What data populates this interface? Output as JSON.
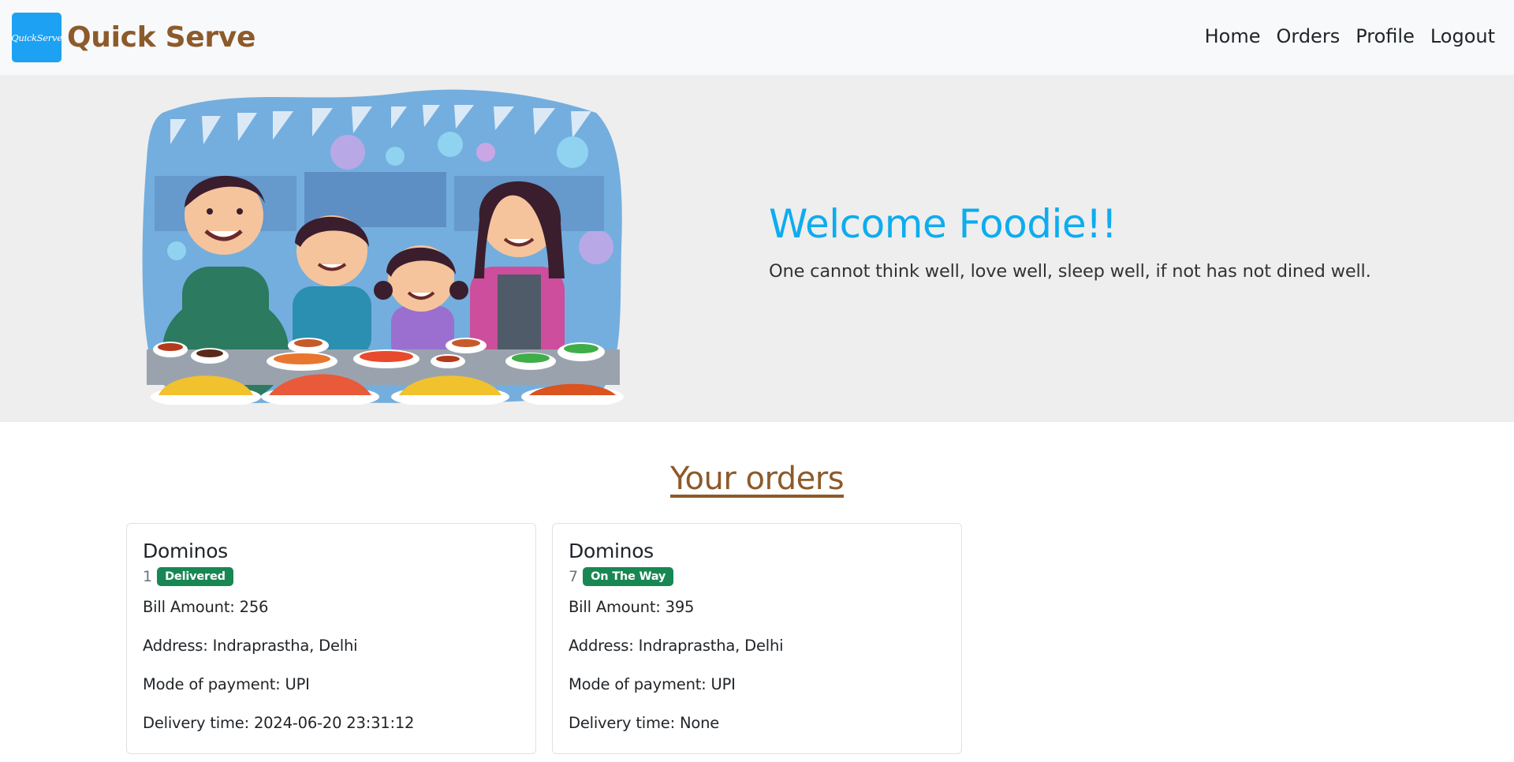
{
  "navbar": {
    "logo_text": "QuickServe",
    "brand_name": "Quick Serve",
    "links": [
      {
        "label": "Home"
      },
      {
        "label": "Orders"
      },
      {
        "label": "Profile"
      },
      {
        "label": "Logout"
      }
    ]
  },
  "hero": {
    "title": "Welcome Foodie!!",
    "subtitle": "One cannot think well, love well, sleep well, if not has not dined well."
  },
  "orders": {
    "heading": "Your orders",
    "cards": [
      {
        "restaurant": "Dominos",
        "order_id": "1",
        "status": "Delivered",
        "status_color": "#198754",
        "bill": "Bill Amount: 256",
        "address": "Address: Indraprastha, Delhi",
        "payment": "Mode of payment: UPI",
        "delivery_time": "Delivery time: 2024-06-20 23:31:12"
      },
      {
        "restaurant": "Dominos",
        "order_id": "7",
        "status": "On The Way",
        "status_color": "#198754",
        "bill": "Bill Amount: 395",
        "address": "Address: Indraprastha, Delhi",
        "payment": "Mode of payment: UPI",
        "delivery_time": "Delivery time: None"
      }
    ]
  },
  "colors": {
    "brand": "#8d5a2b",
    "accent": "#0dacef",
    "logo_bg": "#1da1f2",
    "navbar_bg": "#f8f9fa",
    "hero_bg": "#eeeeee",
    "badge_success": "#198754"
  }
}
